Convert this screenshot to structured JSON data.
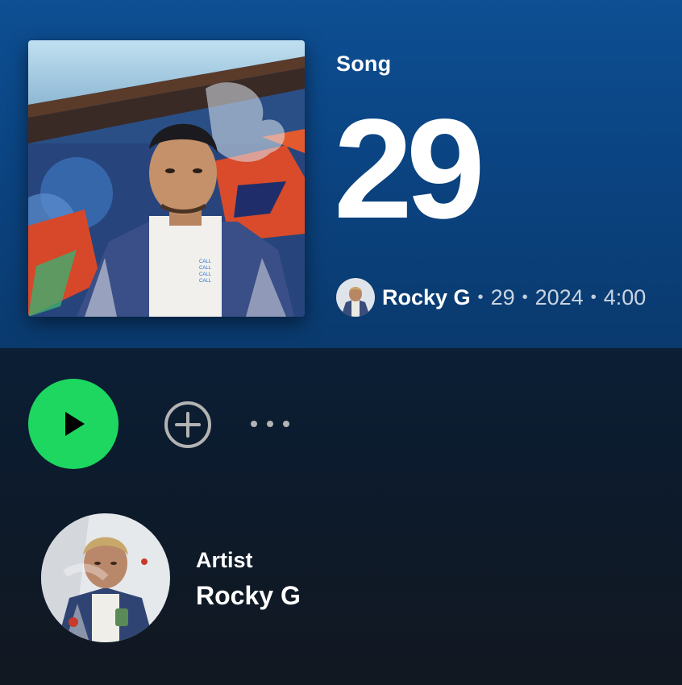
{
  "header": {
    "type_label": "Song",
    "title": "29",
    "artist": "Rocky G",
    "album": "29",
    "year": "2024",
    "duration": "4:00",
    "separator": "•"
  },
  "actions": {
    "play_icon": "play-icon",
    "add_icon": "plus-circle-icon",
    "more_icon": "more-horizontal-icon"
  },
  "artist_row": {
    "label": "Artist",
    "name": "Rocky G"
  },
  "colors": {
    "accent": "#1ed760",
    "hero_background": "#0b4584",
    "page_background": "#121821"
  }
}
